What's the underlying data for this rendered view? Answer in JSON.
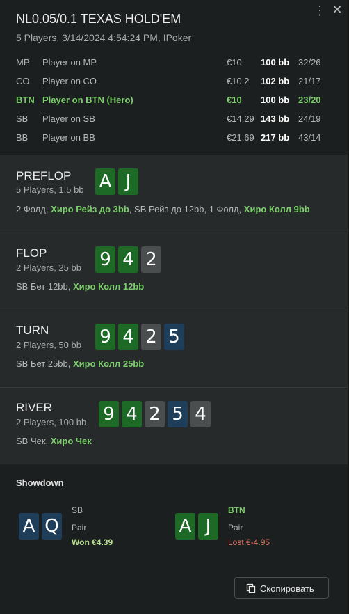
{
  "header": {
    "title": "NL0.05/0.1 TEXAS HOLD'EM",
    "subtitle": "5 Players, 3/14/2024 4:54:24 PM, IPoker",
    "kebab_icon": "more-vertical-icon",
    "close_icon": "close-icon"
  },
  "players": [
    {
      "pos": "MP",
      "name": "Player on MP",
      "stack": "€10",
      "bb": "100 bb",
      "stats": "32/26",
      "hero": false
    },
    {
      "pos": "CO",
      "name": "Player on CO",
      "stack": "€10.2",
      "bb": "102 bb",
      "stats": "21/17",
      "hero": false
    },
    {
      "pos": "BTN",
      "name": "Player on BTN (Hero)",
      "stack": "€10",
      "bb": "100 bb",
      "stats": "23/20",
      "hero": true
    },
    {
      "pos": "SB",
      "name": "Player on SB",
      "stack": "€14.29",
      "bb": "143 bb",
      "stats": "24/19",
      "hero": false
    },
    {
      "pos": "BB",
      "name": "Player on BB",
      "stack": "€21.69",
      "bb": "217 bb",
      "stats": "43/14",
      "hero": false
    }
  ],
  "streets": {
    "preflop": {
      "name": "PREFLOP",
      "info": "5 Players, 1.5 bb",
      "cards": [
        "A",
        "J"
      ],
      "actions": {
        "a1": "2 Фолд, ",
        "h1": "Хиро Рейз до 3bb",
        "a2": ", SB Рейз до 12bb, 1 Фолд, ",
        "h2": "Хиро Колл 9bb"
      }
    },
    "flop": {
      "name": "FLOP",
      "info": "2 Players, 25 bb",
      "cards": [
        "9",
        "4",
        "2"
      ],
      "actions": {
        "a1": "SB Бет 12bb, ",
        "h1": "Хиро Колл 12bb"
      }
    },
    "turn": {
      "name": "TURN",
      "info": "2 Players, 50 bb",
      "cards": [
        "9",
        "4",
        "2",
        "5"
      ],
      "actions": {
        "a1": "SB Бет 25bb, ",
        "h1": "Хиро Колл 25bb"
      }
    },
    "river": {
      "name": "RIVER",
      "info": "2 Players, 100 bb",
      "cards": [
        "9",
        "4",
        "2",
        "5",
        "4"
      ],
      "actions": {
        "a1": "SB Чек, ",
        "h1": "Хиро Чек"
      }
    }
  },
  "showdown": {
    "title": "Showdown",
    "sb": {
      "cards": [
        "A",
        "Q"
      ],
      "position": "SB",
      "hand": "Pair",
      "result": "Won €4.39"
    },
    "btn": {
      "cards": [
        "A",
        "J"
      ],
      "position": "BTN",
      "hand": "Pair",
      "result": "Lost €-4.95"
    }
  },
  "copy_button": {
    "label": "Скопировать",
    "icon": "copy-icon"
  },
  "colors": {
    "card_green": "#1d6a27",
    "card_gray": "#4a4e4e",
    "card_blue": "#1f3e5a",
    "hero_green": "#7ccf6c",
    "won": "#b9e08e",
    "lost": "#e07766"
  }
}
